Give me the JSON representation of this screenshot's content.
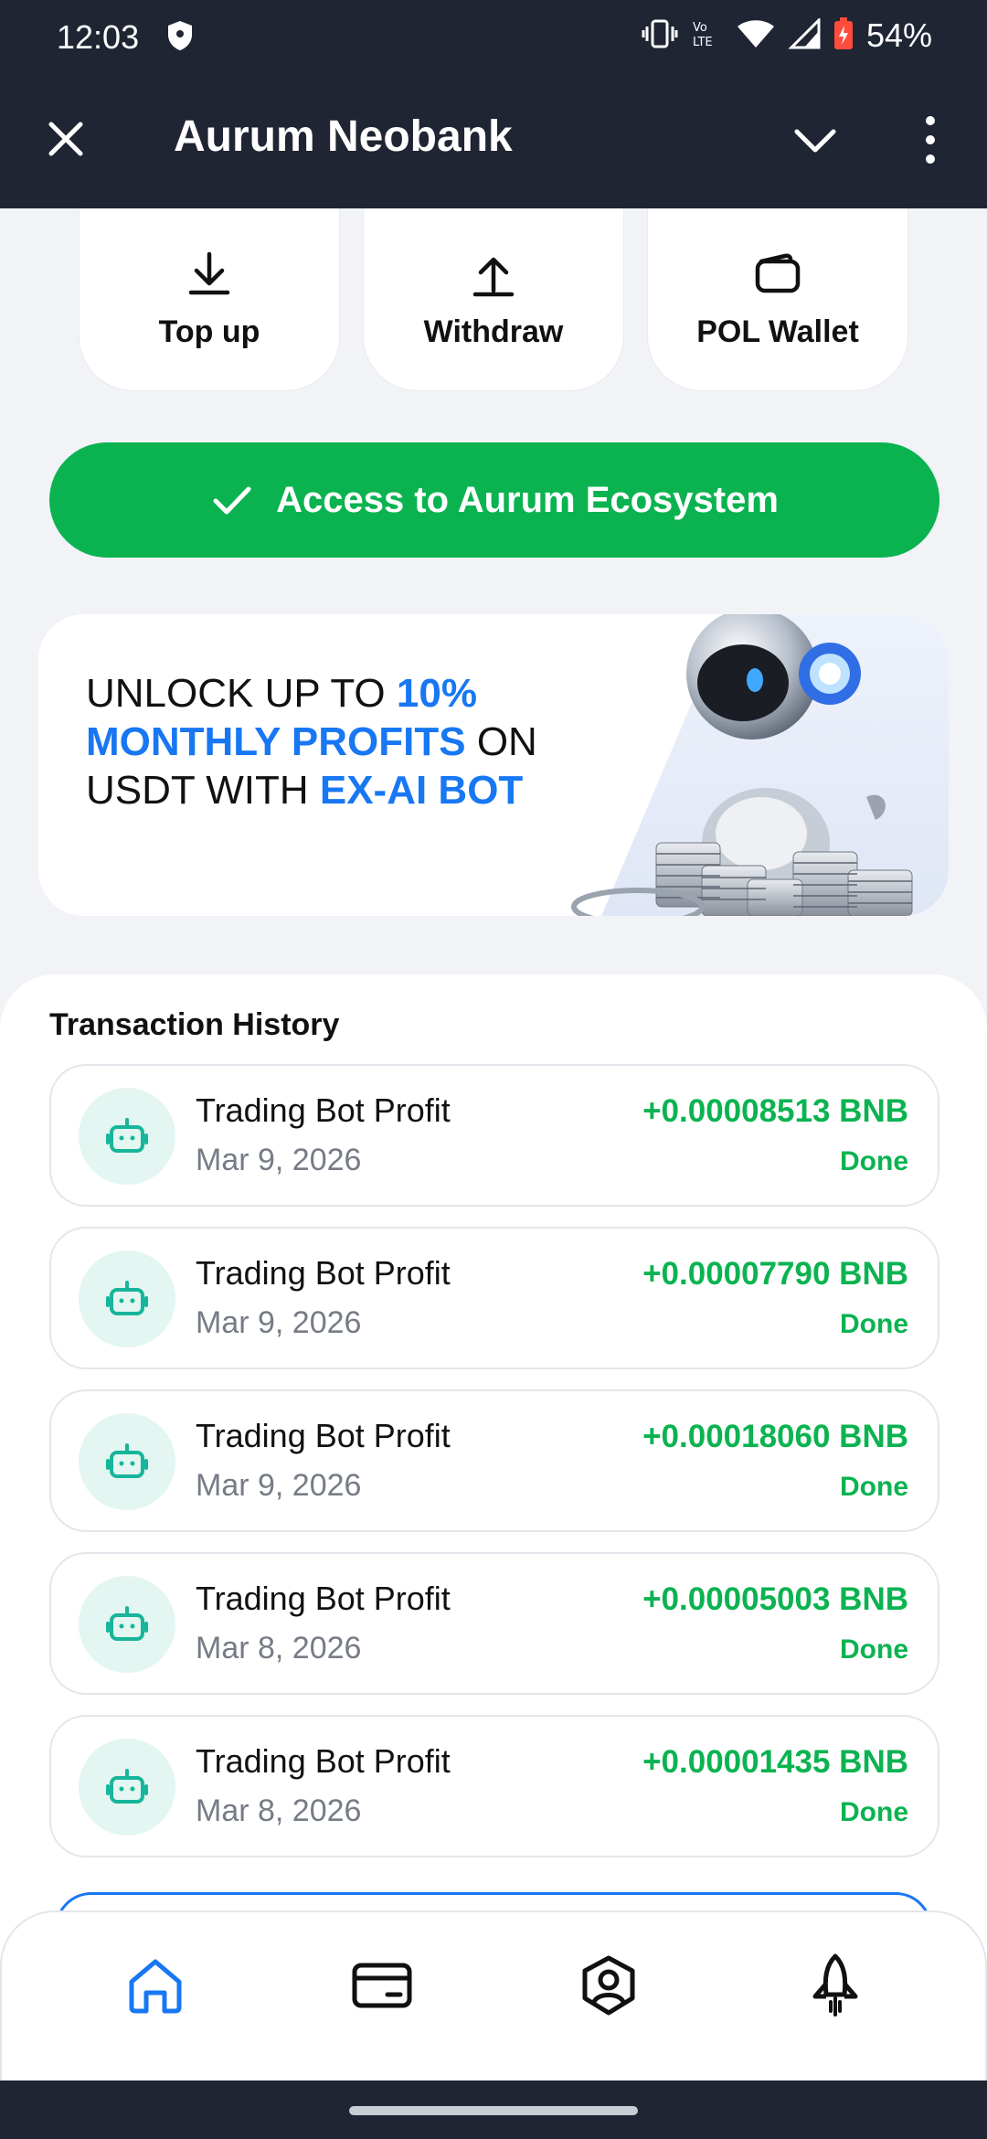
{
  "status_bar": {
    "time": "12:03",
    "battery": "54%",
    "icons": [
      "shield-icon",
      "vibrate-icon",
      "volte-icon",
      "wifi-icon",
      "signal-icon",
      "battery-icon"
    ]
  },
  "app_bar": {
    "title": "Aurum Neobank"
  },
  "actions": [
    {
      "label": "Top up",
      "icon": "download-icon"
    },
    {
      "label": "Withdraw",
      "icon": "upload-icon"
    },
    {
      "label": "POL Wallet",
      "icon": "wallet-icon"
    }
  ],
  "access_button": {
    "label": "Access to Aurum Ecosystem"
  },
  "banner": {
    "part1": "Unlock up to ",
    "part2": "10% monthly profits",
    "part3": " on USDT with ",
    "part4": "EX-AI Bot"
  },
  "transactions": {
    "heading": "Transaction History",
    "items": [
      {
        "name": "Trading Bot Profit",
        "date": "Mar 9, 2026",
        "amount": "+0.00008513 BNB",
        "status": "Done"
      },
      {
        "name": "Trading Bot Profit",
        "date": "Mar 9, 2026",
        "amount": "+0.00007790 BNB",
        "status": "Done"
      },
      {
        "name": "Trading Bot Profit",
        "date": "Mar 9, 2026",
        "amount": "+0.00018060 BNB",
        "status": "Done"
      },
      {
        "name": "Trading Bot Profit",
        "date": "Mar 8, 2026",
        "amount": "+0.00005003 BNB",
        "status": "Done"
      },
      {
        "name": "Trading Bot Profit",
        "date": "Mar 8, 2026",
        "amount": "+0.00001435 BNB",
        "status": "Done"
      }
    ]
  },
  "bottom_nav": {
    "items": [
      "home-icon",
      "card-icon",
      "profile-icon",
      "rocket-icon"
    ],
    "active": "home-icon"
  },
  "colors": {
    "header": "#1f2533",
    "accent_green": "#0bb350",
    "accent_blue": "#1877f2"
  }
}
